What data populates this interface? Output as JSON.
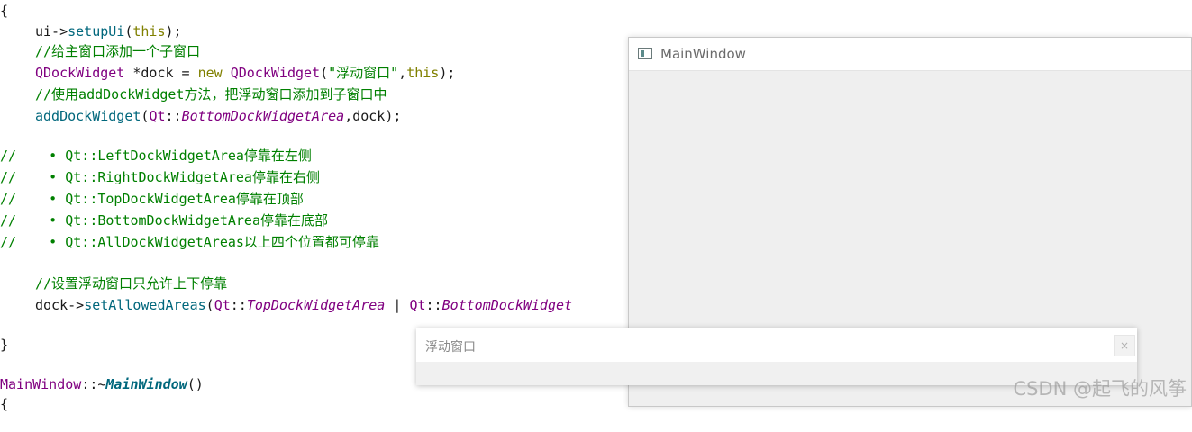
{
  "code": {
    "l1": "{",
    "l2_a": "ui->",
    "l2_fn": "setupUi",
    "l2_b": "(",
    "l2_kw": "this",
    "l2_c": ");",
    "l3": "//给主窗口添加一个子窗口",
    "l4_cls1": "QDockWidget",
    "l4_a": " *dock = ",
    "l4_kw": "new",
    "l4_sp": " ",
    "l4_cls2": "QDockWidget",
    "l4_b": "(",
    "l4_str": "\"浮动窗口\"",
    "l4_c": ",",
    "l4_kw2": "this",
    "l4_d": ");",
    "l5": "//使用addDockWidget方法，把浮动窗口添加到子窗口中",
    "l6_fn": "addDockWidget",
    "l6_a": "(",
    "l6_cls": "Qt",
    "l6_b": "::",
    "l6_enum": "BottomDockWidgetArea",
    "l6_c": ",dock);",
    "c1": "//    • Qt::LeftDockWidgetArea停靠在左侧",
    "c2": "//    • Qt::RightDockWidgetArea停靠在右侧",
    "c3": "//    • Qt::TopDockWidgetArea停靠在顶部",
    "c4": "//    • Qt::BottomDockWidgetArea停靠在底部",
    "c5": "//    • Qt::AllDockWidgetAreas以上四个位置都可停靠",
    "l7": "//设置浮动窗口只允许上下停靠",
    "l8_a": "dock->",
    "l8_fn": "setAllowedAreas",
    "l8_b": "(",
    "l8_cls": "Qt",
    "l8_c": "::",
    "l8_enum": "TopDockWidgetArea",
    "l8_d": " | ",
    "l8_cls2": "Qt",
    "l8_e": "::",
    "l8_enum2": "BottomDockWidget",
    "l9": "}",
    "l10_cls": "MainWindow",
    "l10_a": "::~",
    "l10_fn": "MainWindow",
    "l10_b": "()",
    "l11": "{"
  },
  "main_window": {
    "title": "MainWindow",
    "icon": "window-icon"
  },
  "dock": {
    "title": "浮动窗口",
    "close_label": "×"
  },
  "watermark": "CSDN @起飞的风筝",
  "colors": {
    "function": "#00677c",
    "keyword": "#808000",
    "class": "#800080",
    "comment": "#008000"
  }
}
